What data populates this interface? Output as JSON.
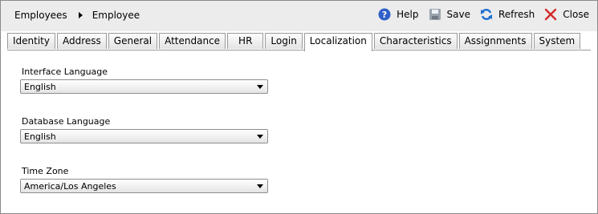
{
  "breadcrumb": {
    "items": [
      "Employees",
      "Employee"
    ]
  },
  "toolbar": {
    "help_label": "Help",
    "save_label": "Save",
    "refresh_label": "Refresh",
    "close_label": "Close"
  },
  "tabs": [
    {
      "label": "Identity"
    },
    {
      "label": "Address"
    },
    {
      "label": "General"
    },
    {
      "label": "Attendance"
    },
    {
      "label": "HR"
    },
    {
      "label": "Login"
    },
    {
      "label": "Localization",
      "active": true
    },
    {
      "label": "Characteristics"
    },
    {
      "label": "Assignments"
    },
    {
      "label": "System"
    }
  ],
  "form": {
    "interface_language": {
      "label": "Interface Language",
      "value": "English"
    },
    "database_language": {
      "label": "Database Language",
      "value": "English"
    },
    "time_zone": {
      "label": "Time Zone",
      "value": "America/Los Angeles"
    }
  },
  "colors": {
    "help_icon": "#2f5fc8",
    "save_icon": "#9aa3ad",
    "refresh_icon": "#1f6fd1",
    "close_icon": "#d42a2a"
  },
  "icons": [
    "help-icon",
    "save-icon",
    "refresh-icon",
    "close-icon",
    "breadcrumb-arrow-icon",
    "chevron-down-icon"
  ]
}
